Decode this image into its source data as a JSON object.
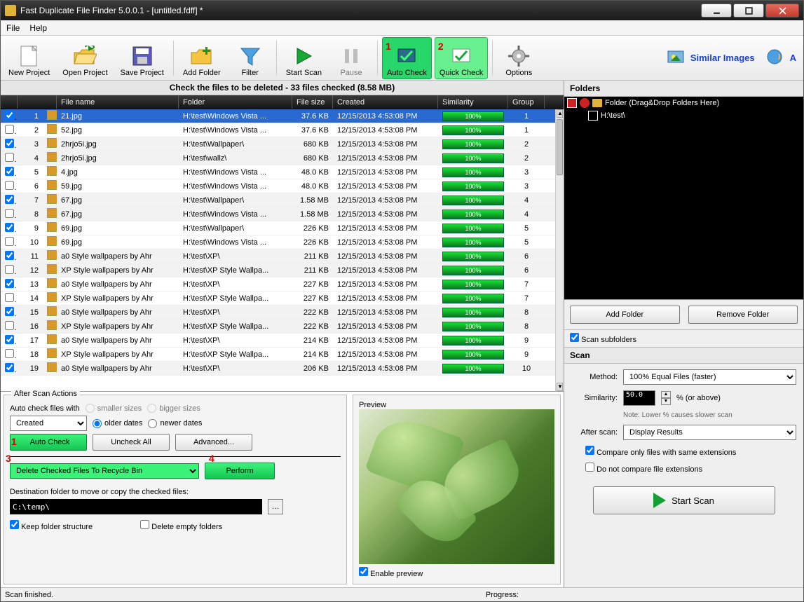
{
  "titlebar": {
    "title": "Fast Duplicate File Finder 5.0.0.1 - [untitled.fdff] *"
  },
  "menubar": {
    "file": "File",
    "help": "Help"
  },
  "toolbar": {
    "new_project": "New Project",
    "open_project": "Open Project",
    "save_project": "Save Project",
    "add_folder": "Add Folder",
    "filter": "Filter",
    "start_scan": "Start Scan",
    "pause": "Pause",
    "auto_check": "Auto Check",
    "quick_check": "Quick Check",
    "options": "Options",
    "similar_images": "Similar Images",
    "badge1": "1",
    "badge2": "2"
  },
  "check_header": "Check the files to be deleted - 33 files checked (8.58 MB)",
  "columns": {
    "name": "File name",
    "folder": "Folder",
    "size": "File size",
    "created": "Created",
    "similarity": "Similarity",
    "group": "Group"
  },
  "rows": [
    {
      "chk": true,
      "n": 1,
      "name": "21.jpg",
      "folder": "H:\\test\\Windows Vista ...",
      "size": "37.6 KB",
      "date": "12/15/2013 4:53:08 PM",
      "sim": "100%",
      "grp": "1",
      "sel": true
    },
    {
      "chk": false,
      "n": 2,
      "name": "52.jpg",
      "folder": "H:\\test\\Windows Vista ...",
      "size": "37.6 KB",
      "date": "12/15/2013 4:53:08 PM",
      "sim": "100%",
      "grp": "1"
    },
    {
      "chk": true,
      "n": 3,
      "name": "2hrjo5i.jpg",
      "folder": "H:\\test\\Wallpaper\\",
      "size": "680 KB",
      "date": "12/15/2013 4:53:08 PM",
      "sim": "100%",
      "grp": "2"
    },
    {
      "chk": false,
      "n": 4,
      "name": "2hrjo5i.jpg",
      "folder": "H:\\test\\wallz\\",
      "size": "680 KB",
      "date": "12/15/2013 4:53:08 PM",
      "sim": "100%",
      "grp": "2"
    },
    {
      "chk": true,
      "n": 5,
      "name": "4.jpg",
      "folder": "H:\\test\\Windows Vista ...",
      "size": "48.0 KB",
      "date": "12/15/2013 4:53:08 PM",
      "sim": "100%",
      "grp": "3"
    },
    {
      "chk": false,
      "n": 6,
      "name": "59.jpg",
      "folder": "H:\\test\\Windows Vista ...",
      "size": "48.0 KB",
      "date": "12/15/2013 4:53:08 PM",
      "sim": "100%",
      "grp": "3"
    },
    {
      "chk": true,
      "n": 7,
      "name": "67.jpg",
      "folder": "H:\\test\\Wallpaper\\",
      "size": "1.58 MB",
      "date": "12/15/2013 4:53:08 PM",
      "sim": "100%",
      "grp": "4"
    },
    {
      "chk": false,
      "n": 8,
      "name": "67.jpg",
      "folder": "H:\\test\\Windows Vista ...",
      "size": "1.58 MB",
      "date": "12/15/2013 4:53:08 PM",
      "sim": "100%",
      "grp": "4"
    },
    {
      "chk": true,
      "n": 9,
      "name": "69.jpg",
      "folder": "H:\\test\\Wallpaper\\",
      "size": "226 KB",
      "date": "12/15/2013 4:53:08 PM",
      "sim": "100%",
      "grp": "5"
    },
    {
      "chk": false,
      "n": 10,
      "name": "69.jpg",
      "folder": "H:\\test\\Windows Vista ...",
      "size": "226 KB",
      "date": "12/15/2013 4:53:08 PM",
      "sim": "100%",
      "grp": "5"
    },
    {
      "chk": true,
      "n": 11,
      "name": "a0 Style wallpapers by Ahr",
      "folder": "H:\\test\\XP\\",
      "size": "211 KB",
      "date": "12/15/2013 4:53:08 PM",
      "sim": "100%",
      "grp": "6"
    },
    {
      "chk": false,
      "n": 12,
      "name": "XP Style wallpapers by Ahr",
      "folder": "H:\\test\\XP Style Wallpa...",
      "size": "211 KB",
      "date": "12/15/2013 4:53:08 PM",
      "sim": "100%",
      "grp": "6"
    },
    {
      "chk": true,
      "n": 13,
      "name": "a0 Style wallpapers by Ahr",
      "folder": "H:\\test\\XP\\",
      "size": "227 KB",
      "date": "12/15/2013 4:53:08 PM",
      "sim": "100%",
      "grp": "7"
    },
    {
      "chk": false,
      "n": 14,
      "name": "XP Style wallpapers by Ahr",
      "folder": "H:\\test\\XP Style Wallpa...",
      "size": "227 KB",
      "date": "12/15/2013 4:53:08 PM",
      "sim": "100%",
      "grp": "7"
    },
    {
      "chk": true,
      "n": 15,
      "name": "a0 Style wallpapers by Ahr",
      "folder": "H:\\test\\XP\\",
      "size": "222 KB",
      "date": "12/15/2013 4:53:08 PM",
      "sim": "100%",
      "grp": "8"
    },
    {
      "chk": false,
      "n": 16,
      "name": "XP Style wallpapers by Ahr",
      "folder": "H:\\test\\XP Style Wallpa...",
      "size": "222 KB",
      "date": "12/15/2013 4:53:08 PM",
      "sim": "100%",
      "grp": "8"
    },
    {
      "chk": true,
      "n": 17,
      "name": "a0 Style wallpapers by Ahr",
      "folder": "H:\\test\\XP\\",
      "size": "214 KB",
      "date": "12/15/2013 4:53:08 PM",
      "sim": "100%",
      "grp": "9"
    },
    {
      "chk": false,
      "n": 18,
      "name": "XP Style wallpapers by Ahr",
      "folder": "H:\\test\\XP Style Wallpa...",
      "size": "214 KB",
      "date": "12/15/2013 4:53:08 PM",
      "sim": "100%",
      "grp": "9"
    },
    {
      "chk": true,
      "n": 19,
      "name": "a0 Style wallpapers by Ahr",
      "folder": "H:\\test\\XP\\",
      "size": "206 KB",
      "date": "12/15/2013 4:53:08 PM",
      "sim": "100%",
      "grp": "10"
    }
  ],
  "after_scan": {
    "legend": "After Scan Actions",
    "auto_check_with": "Auto check files with",
    "smaller": "smaller sizes",
    "bigger": "bigger sizes",
    "older": "older dates",
    "newer": "newer dates",
    "criteria": "Created",
    "auto_check_btn": "Auto Check",
    "uncheck_all": "Uncheck All",
    "advanced": "Advanced...",
    "action_select": "Delete Checked Files To Recycle Bin",
    "perform": "Perform",
    "dest_label": "Destination folder to move or copy the checked files:",
    "dest_value": "C:\\temp\\",
    "keep_structure": "Keep folder structure",
    "delete_empty": "Delete empty folders",
    "badge1": "1",
    "badge3": "3",
    "badge4": "4"
  },
  "preview": {
    "legend": "Preview",
    "enable": "Enable preview"
  },
  "folders": {
    "header": "Folders",
    "root": "Folder (Drag&Drop Folders Here)",
    "item1": "H:\\test\\",
    "add": "Add Folder",
    "remove": "Remove Folder",
    "scan_sub": "Scan subfolders"
  },
  "scan": {
    "header": "Scan",
    "method_lbl": "Method:",
    "method_val": "100% Equal Files (faster)",
    "sim_lbl": "Similarity:",
    "sim_val": "50.0",
    "pct_above": "%  (or above)",
    "note": "Note: Lower % causes slower scan",
    "after_lbl": "After scan:",
    "after_val": "Display Results",
    "compare_ext": "Compare only files with same extensions",
    "no_compare_ext": "Do not compare file extensions",
    "start": "Start Scan"
  },
  "status": {
    "left": "Scan finished.",
    "progress": "Progress:"
  }
}
